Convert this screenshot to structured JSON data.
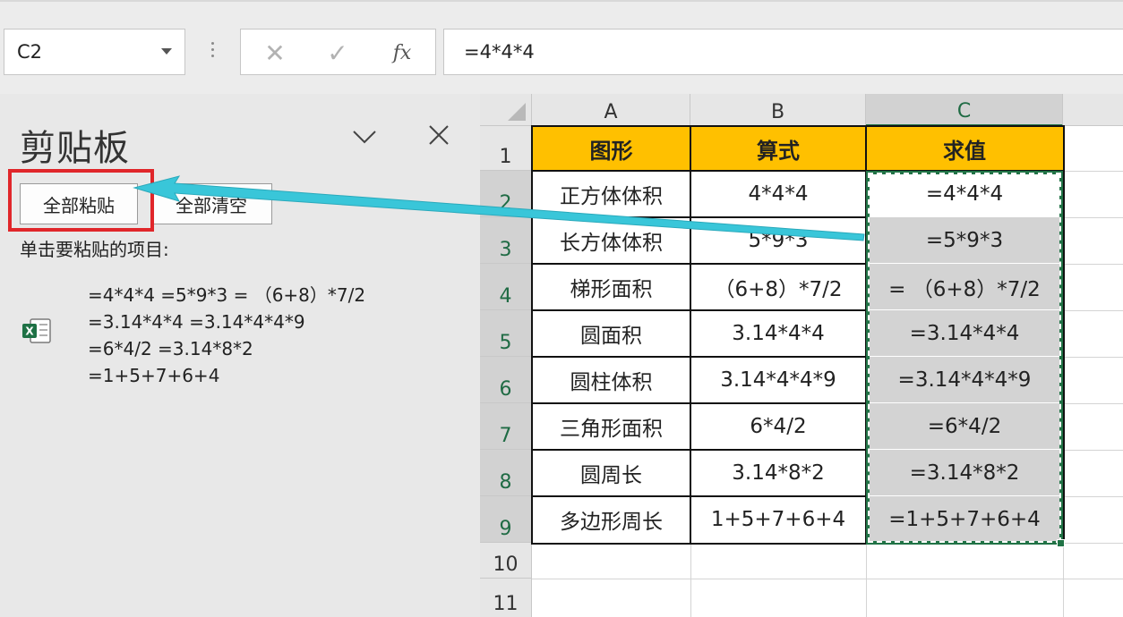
{
  "formula_bar": {
    "name_box": "C2",
    "cancel_icon": "✕",
    "enter_icon": "✓",
    "fx_label": "fx",
    "formula": "=4*4*4"
  },
  "clipboard": {
    "title": "剪贴板",
    "paste_all": "全部粘贴",
    "clear_all": "全部清空",
    "hint": "单击要粘贴的项目:",
    "item_icon": "excel-icon",
    "item_lines": [
      "=4*4*4 =5*9*3 = （6+8）*7/2",
      "=3.14*4*4 =3.14*4*4*9",
      "=6*4/2 =3.14*8*2",
      "=1+5+7+6+4"
    ]
  },
  "sheet": {
    "columns": [
      "A",
      "B",
      "C"
    ],
    "rows": [
      "1",
      "2",
      "3",
      "4",
      "5",
      "6",
      "7",
      "8",
      "9",
      "10",
      "11"
    ],
    "headers": [
      "图形",
      "算式",
      "求值"
    ],
    "data": [
      [
        "正方体体积",
        "4*4*4",
        "=4*4*4"
      ],
      [
        "长方体体积",
        "5*9*3",
        "=5*9*3"
      ],
      [
        "梯形面积",
        "（6+8）*7/2",
        "= （6+8）*7/2"
      ],
      [
        "圆面积",
        "3.14*4*4",
        "=3.14*4*4"
      ],
      [
        "圆柱体积",
        "3.14*4*4*9",
        "=3.14*4*4*9"
      ],
      [
        "三角形面积",
        "6*4/2",
        "=6*4/2"
      ],
      [
        "圆周长",
        "3.14*8*2",
        "=3.14*8*2"
      ],
      [
        "多边形周长",
        "1+5+7+6+4",
        "=1+5+7+6+4"
      ]
    ],
    "header_color": "#ffc000",
    "selection_color": "#217346"
  },
  "annotation": {
    "highlight_color": "#e0262a",
    "arrow_color": "#39c6d9"
  }
}
